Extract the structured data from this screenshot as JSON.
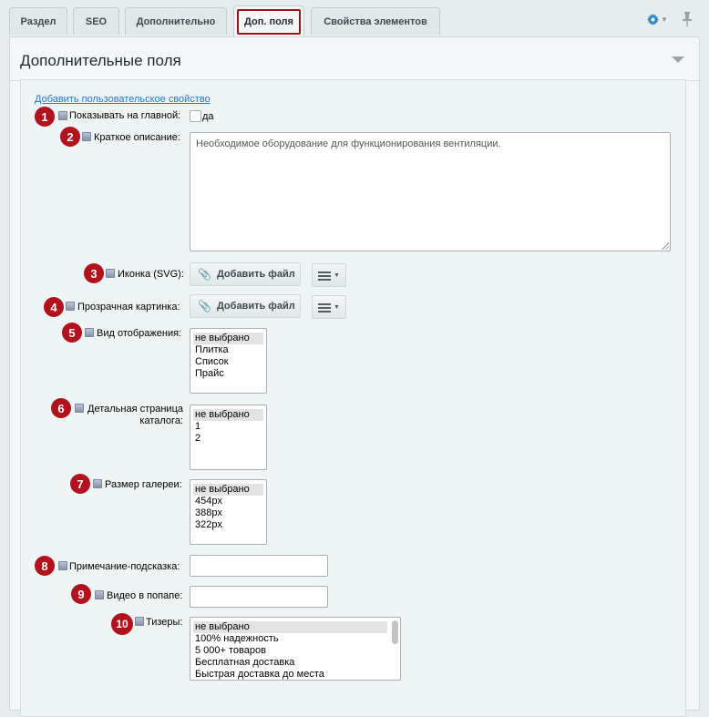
{
  "tabs": [
    "Раздел",
    "SEO",
    "Дополнительно",
    "Доп. поля",
    "Свойства элементов"
  ],
  "panel": {
    "title": "Дополнительные поля"
  },
  "form": {
    "add_property_link": "Добавить пользовательское свойство",
    "fields": {
      "show_on_main": {
        "badge": "1",
        "label": "Показывать на главной:",
        "checkbox_label": "да"
      },
      "short_description": {
        "badge": "2",
        "label": "Краткое описание:",
        "value": "Необходимое оборудование для функционирования вентиляции."
      },
      "icon_svg": {
        "badge": "3",
        "label": "Иконка (SVG):",
        "button": "Добавить файл"
      },
      "transparent_image": {
        "badge": "4",
        "label": "Прозрачная картинка:",
        "button": "Добавить файл"
      },
      "display_view": {
        "badge": "5",
        "label": "Вид отображения:",
        "options": [
          "не выбрано",
          "Плитка",
          "Список",
          "Прайс"
        ]
      },
      "catalog_detail": {
        "badge": "6",
        "label_line1": "Детальная страница",
        "label_line2": "каталога:",
        "options": [
          "не выбрано",
          "1",
          "2"
        ]
      },
      "gallery_size": {
        "badge": "7",
        "label": "Размер галереи:",
        "options": [
          "не выбрано",
          "454px",
          "388px",
          "322px"
        ]
      },
      "tooltip_note": {
        "badge": "8",
        "label": "Примечание-подсказка:",
        "value": ""
      },
      "popup_video": {
        "badge": "9",
        "label": "Видео в попапе:",
        "value": ""
      },
      "teasers": {
        "badge": "10",
        "label": "Тизеры:",
        "options": [
          "не выбрано",
          "100% надежность",
          "5 000+ товаров",
          "Бесплатная доставка",
          "Быстрая доставка до места"
        ]
      }
    }
  },
  "colors": {
    "badge": "#b3111c",
    "link": "#2675d7",
    "active_tab_border": "#a30e1b",
    "gear": "#2c87c6"
  }
}
